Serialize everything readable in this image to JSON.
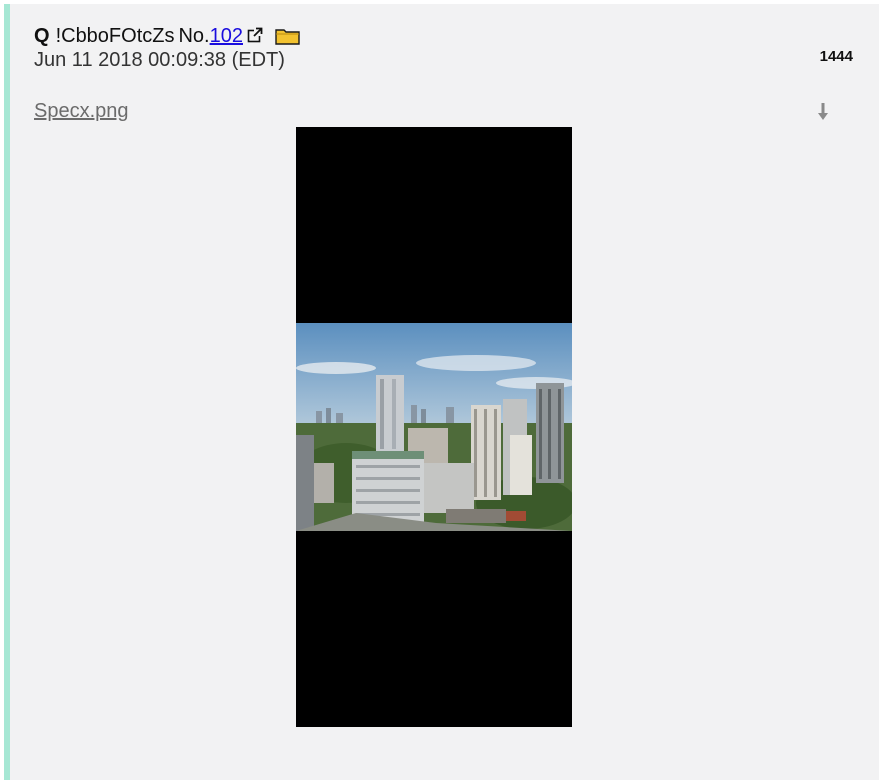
{
  "post": {
    "author": "Q",
    "tripcode": "!CbboFOtcZs",
    "no_label": "No.",
    "post_number": "102",
    "date": "Jun 11 2018 00:09:38 (EDT)",
    "count": "1444",
    "file_name": "Specx.png"
  },
  "icons": {
    "external_link": "external-link-icon",
    "folder": "folder-icon",
    "download": "download-icon"
  },
  "colors": {
    "background": "#f2f2f3",
    "left_border": "#a6e7d4",
    "link": "#1a0dde",
    "file_name": "#6b6b6b",
    "folder": "#f2c230"
  }
}
